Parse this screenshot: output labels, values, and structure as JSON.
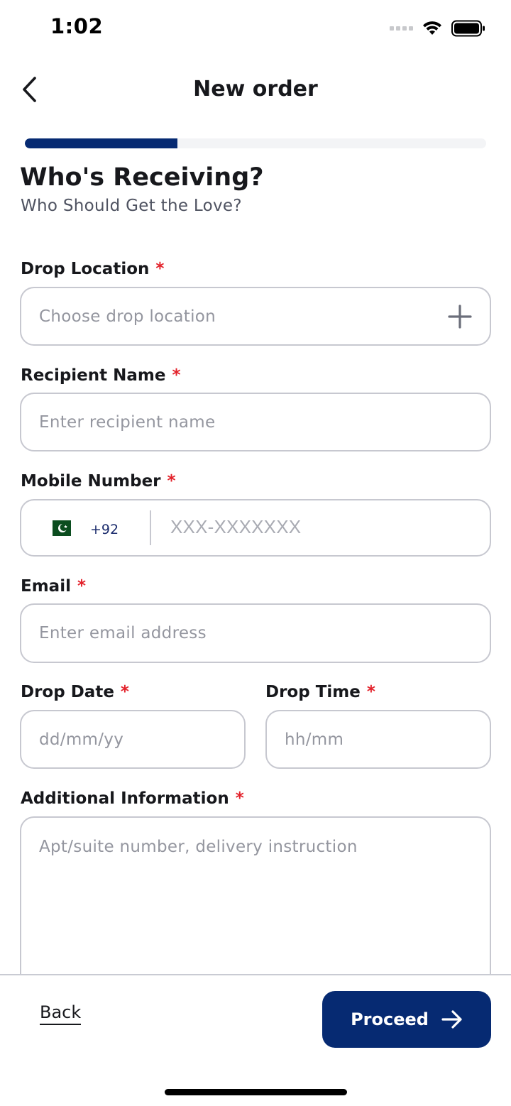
{
  "status_bar": {
    "time": "1:02"
  },
  "header": {
    "title": "New order"
  },
  "progress": {
    "fraction": 0.33
  },
  "section": {
    "title": "Who's Receiving?",
    "subtitle": "Who Should Get the Love?"
  },
  "required_marker": "*",
  "fields": {
    "drop_location": {
      "label": "Drop Location",
      "placeholder": "Choose drop location"
    },
    "recipient_name": {
      "label": "Recipient Name",
      "placeholder": "Enter recipient name"
    },
    "mobile_number": {
      "label": "Mobile Number",
      "dial_code": "+92",
      "placeholder": "XXX-XXXXXXX",
      "flag_icon": "pakistan-flag-icon"
    },
    "email": {
      "label": "Email",
      "placeholder": "Enter email address"
    },
    "drop_date": {
      "label": "Drop Date",
      "placeholder": "dd/mm/yy"
    },
    "drop_time": {
      "label": "Drop Time",
      "placeholder": "hh/mm"
    },
    "additional_info": {
      "label": "Additional Information",
      "placeholder": "Apt/suite number, delivery instruction"
    }
  },
  "footer": {
    "back_label": "Back",
    "proceed_label": "Proceed"
  },
  "colors": {
    "accent": "#062a72",
    "required": "#e3222b",
    "border": "#c7c8d0"
  }
}
